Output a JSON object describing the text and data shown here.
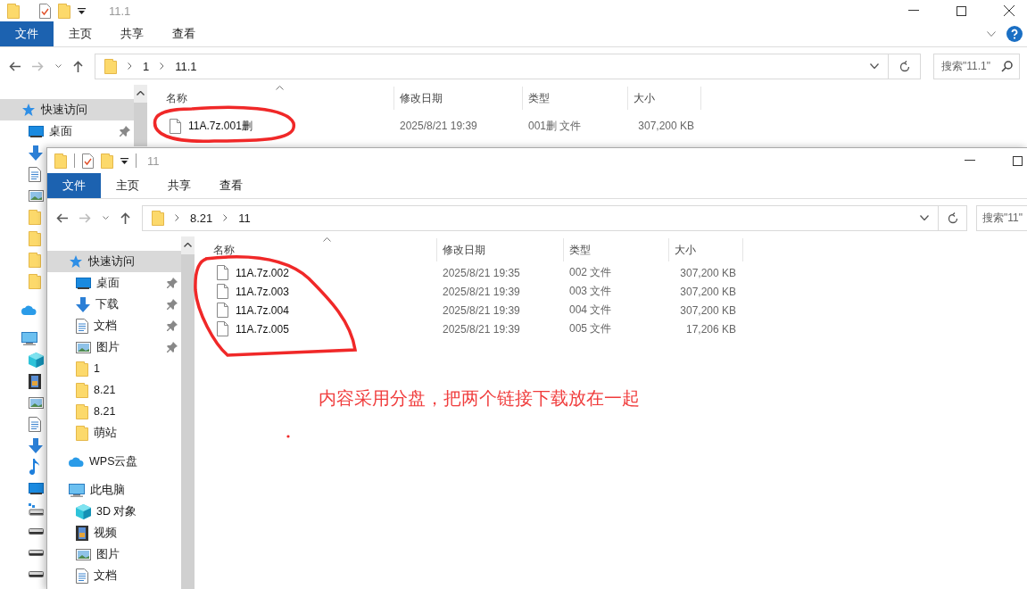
{
  "back_window": {
    "title": "11.1",
    "ribbon_tabs": [
      {
        "label": "文件",
        "selected": true
      },
      {
        "label": "主页",
        "selected": false
      },
      {
        "label": "共享",
        "selected": false
      },
      {
        "label": "查看",
        "selected": false
      }
    ],
    "breadcrumb": [
      "1",
      "11.1"
    ],
    "search": {
      "placeholder": "搜索\"11.1\""
    },
    "columns": [
      "名称",
      "修改日期",
      "类型",
      "大小"
    ],
    "files": [
      {
        "name": "11A.7z.001删",
        "modified": "2025/8/21 19:39",
        "type": "001删 文件",
        "size": "307,200 KB"
      }
    ],
    "nav": [
      {
        "label": "快速访问",
        "kind": "star",
        "selected": true,
        "children": [
          {
            "label": "桌面",
            "kind": "desktop",
            "pinned": true,
            "selected": false
          },
          {
            "kind": "download",
            "selected": false
          },
          {
            "kind": "document",
            "selected": false
          },
          {
            "kind": "pictures",
            "selected": false
          },
          {
            "kind": "folder",
            "selected": false
          },
          {
            "kind": "folder",
            "selected": false
          },
          {
            "kind": "folder",
            "selected": false
          },
          {
            "kind": "folder",
            "selected": false
          }
        ]
      },
      {
        "kind": "cloud",
        "selected": false
      },
      {
        "kind": "computer",
        "selected": false,
        "children": [
          {
            "kind": "cube",
            "selected": false
          },
          {
            "kind": "film",
            "selected": false
          },
          {
            "kind": "pictures",
            "selected": false
          },
          {
            "kind": "document",
            "selected": false
          },
          {
            "kind": "download",
            "selected": false
          },
          {
            "kind": "music",
            "selected": false
          },
          {
            "kind": "desktop",
            "selected": false
          },
          {
            "kind": "netdrive",
            "selected": false
          },
          {
            "kind": "drive",
            "selected": false
          },
          {
            "kind": "drive",
            "selected": false
          },
          {
            "kind": "drive",
            "selected": false
          }
        ]
      }
    ]
  },
  "front_window": {
    "title": "11",
    "ribbon_tabs": [
      {
        "label": "文件",
        "selected": true
      },
      {
        "label": "主页",
        "selected": false
      },
      {
        "label": "共享",
        "selected": false
      },
      {
        "label": "查看",
        "selected": false
      }
    ],
    "breadcrumb": [
      "8.21",
      "11"
    ],
    "search": {
      "placeholder": "搜索\"11\""
    },
    "columns": [
      "名称",
      "修改日期",
      "类型",
      "大小"
    ],
    "files": [
      {
        "name": "11A.7z.002",
        "modified": "2025/8/21 19:35",
        "type": "002 文件",
        "size": "307,200 KB"
      },
      {
        "name": "11A.7z.003",
        "modified": "2025/8/21 19:39",
        "type": "003 文件",
        "size": "307,200 KB"
      },
      {
        "name": "11A.7z.004",
        "modified": "2025/8/21 19:39",
        "type": "004 文件",
        "size": "307,200 KB"
      },
      {
        "name": "11A.7z.005",
        "modified": "2025/8/21 19:39",
        "type": "005 文件",
        "size": "17,206 KB"
      }
    ],
    "nav": [
      {
        "label": "快速访问",
        "kind": "star",
        "selected": true,
        "children": [
          {
            "label": "桌面",
            "kind": "desktop",
            "pinned": true,
            "selected": false
          },
          {
            "label": "下载",
            "kind": "download",
            "pinned": true,
            "selected": false
          },
          {
            "label": "文档",
            "kind": "document",
            "pinned": true,
            "selected": false
          },
          {
            "label": "图片",
            "kind": "pictures",
            "pinned": true,
            "selected": false
          },
          {
            "label": "1",
            "kind": "folder",
            "selected": false
          },
          {
            "label": "8.21",
            "kind": "folder",
            "selected": false
          },
          {
            "label": "8.21",
            "kind": "folder",
            "selected": false
          },
          {
            "label": "萌站",
            "kind": "folder",
            "selected": false
          }
        ]
      },
      {
        "label": "WPS云盘",
        "kind": "cloud",
        "selected": false
      },
      {
        "label": "此电脑",
        "kind": "computer",
        "selected": false,
        "children": [
          {
            "label": "3D 对象",
            "kind": "cube",
            "selected": false
          },
          {
            "label": "视频",
            "kind": "film",
            "selected": false
          },
          {
            "label": "图片",
            "kind": "pictures",
            "selected": false
          },
          {
            "label": "文档",
            "kind": "document",
            "selected": false
          }
        ]
      }
    ]
  },
  "annotation": {
    "text": "内容采用分盘，把两个链接下载放在一起"
  }
}
